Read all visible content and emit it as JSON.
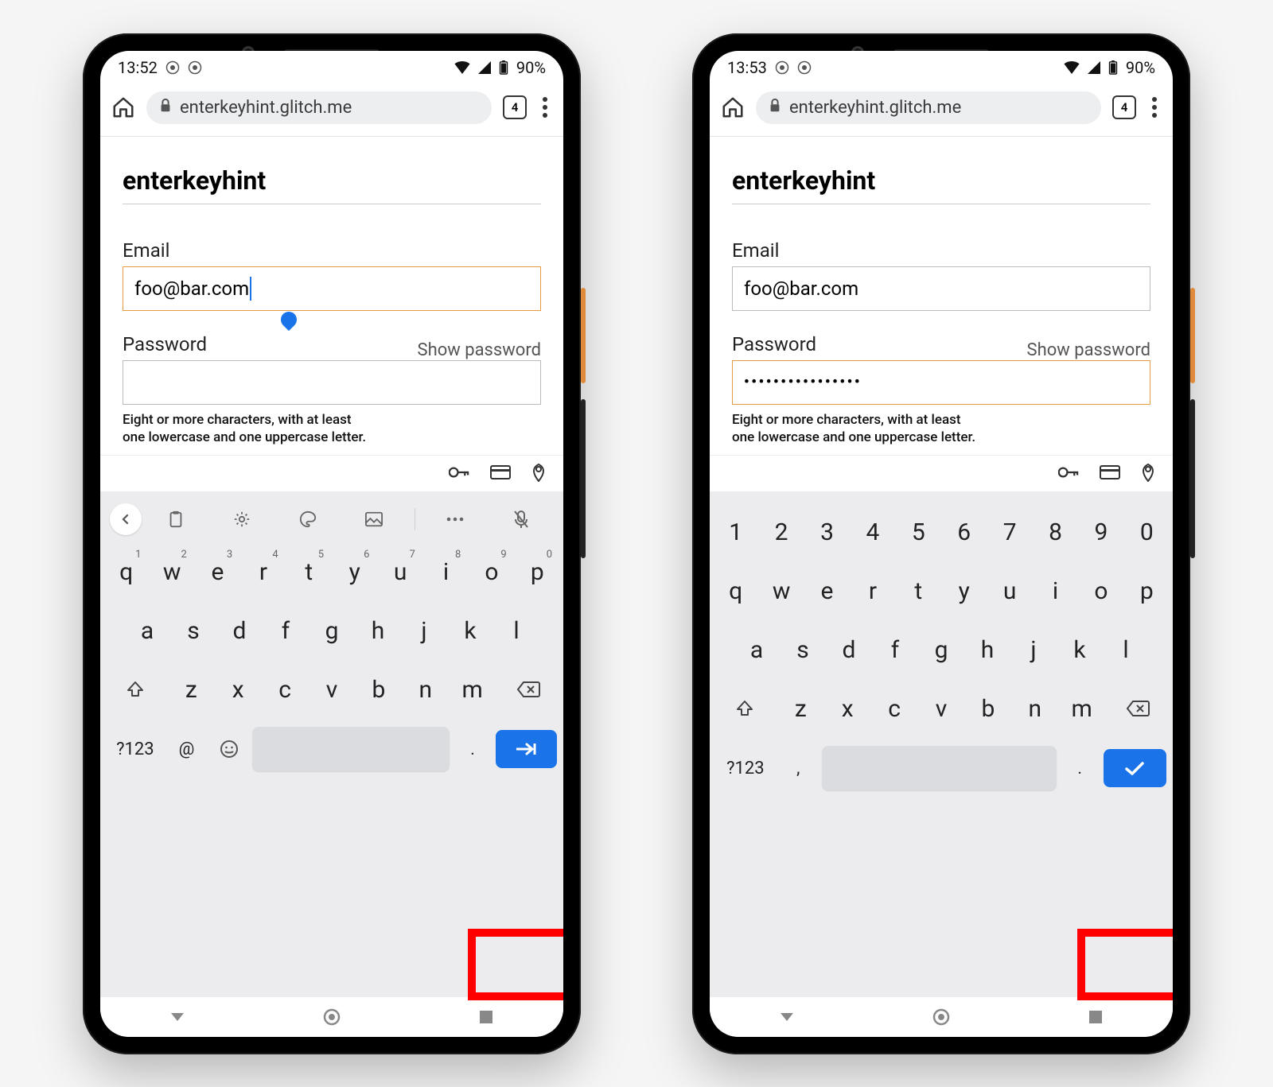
{
  "phones": [
    {
      "status": {
        "time": "13:52",
        "battery": "90%"
      },
      "address": {
        "host": "enterkeyhint.glitch.me",
        "tab_count": "4"
      },
      "page": {
        "title": "enterkeyhint",
        "email_label": "Email",
        "email_value": "foo@bar.com",
        "email_focused": true,
        "password_label": "Password",
        "show_password": "Show password",
        "password_value": "",
        "password_focused": false,
        "hint_l1": "Eight or more characters, with at least",
        "hint_l2": "one lowercase and one uppercase letter."
      },
      "keyboard": {
        "show_toolbar": true,
        "show_number_row": false,
        "rows": {
          "r1": [
            "q",
            "w",
            "e",
            "r",
            "t",
            "y",
            "u",
            "i",
            "o",
            "p"
          ],
          "sup": [
            "1",
            "2",
            "3",
            "4",
            "5",
            "6",
            "7",
            "8",
            "9",
            "0"
          ],
          "r2": [
            "a",
            "s",
            "d",
            "f",
            "g",
            "h",
            "j",
            "k",
            "l"
          ],
          "r3": [
            "z",
            "x",
            "c",
            "v",
            "b",
            "n",
            "m"
          ]
        },
        "bottom": {
          "sym": "?123",
          "left_of_space": "@",
          "right_of_space": "."
        },
        "enter_icon": "arrow-right-to-bar"
      }
    },
    {
      "status": {
        "time": "13:53",
        "battery": "90%"
      },
      "address": {
        "host": "enterkeyhint.glitch.me",
        "tab_count": "4"
      },
      "page": {
        "title": "enterkeyhint",
        "email_label": "Email",
        "email_value": "foo@bar.com",
        "email_focused": false,
        "password_label": "Password",
        "show_password": "Show password",
        "password_value": "••••••••••••••••",
        "password_focused": true,
        "hint_l1": "Eight or more characters, with at least",
        "hint_l2": "one lowercase and one uppercase letter."
      },
      "keyboard": {
        "show_toolbar": false,
        "show_number_row": true,
        "rows": {
          "num": [
            "1",
            "2",
            "3",
            "4",
            "5",
            "6",
            "7",
            "8",
            "9",
            "0"
          ],
          "r1": [
            "q",
            "w",
            "e",
            "r",
            "t",
            "y",
            "u",
            "i",
            "o",
            "p"
          ],
          "r2": [
            "a",
            "s",
            "d",
            "f",
            "g",
            "h",
            "j",
            "k",
            "l"
          ],
          "r3": [
            "z",
            "x",
            "c",
            "v",
            "b",
            "n",
            "m"
          ]
        },
        "bottom": {
          "sym": "?123",
          "left_of_space": ",",
          "right_of_space": "."
        },
        "enter_icon": "check"
      }
    }
  ]
}
